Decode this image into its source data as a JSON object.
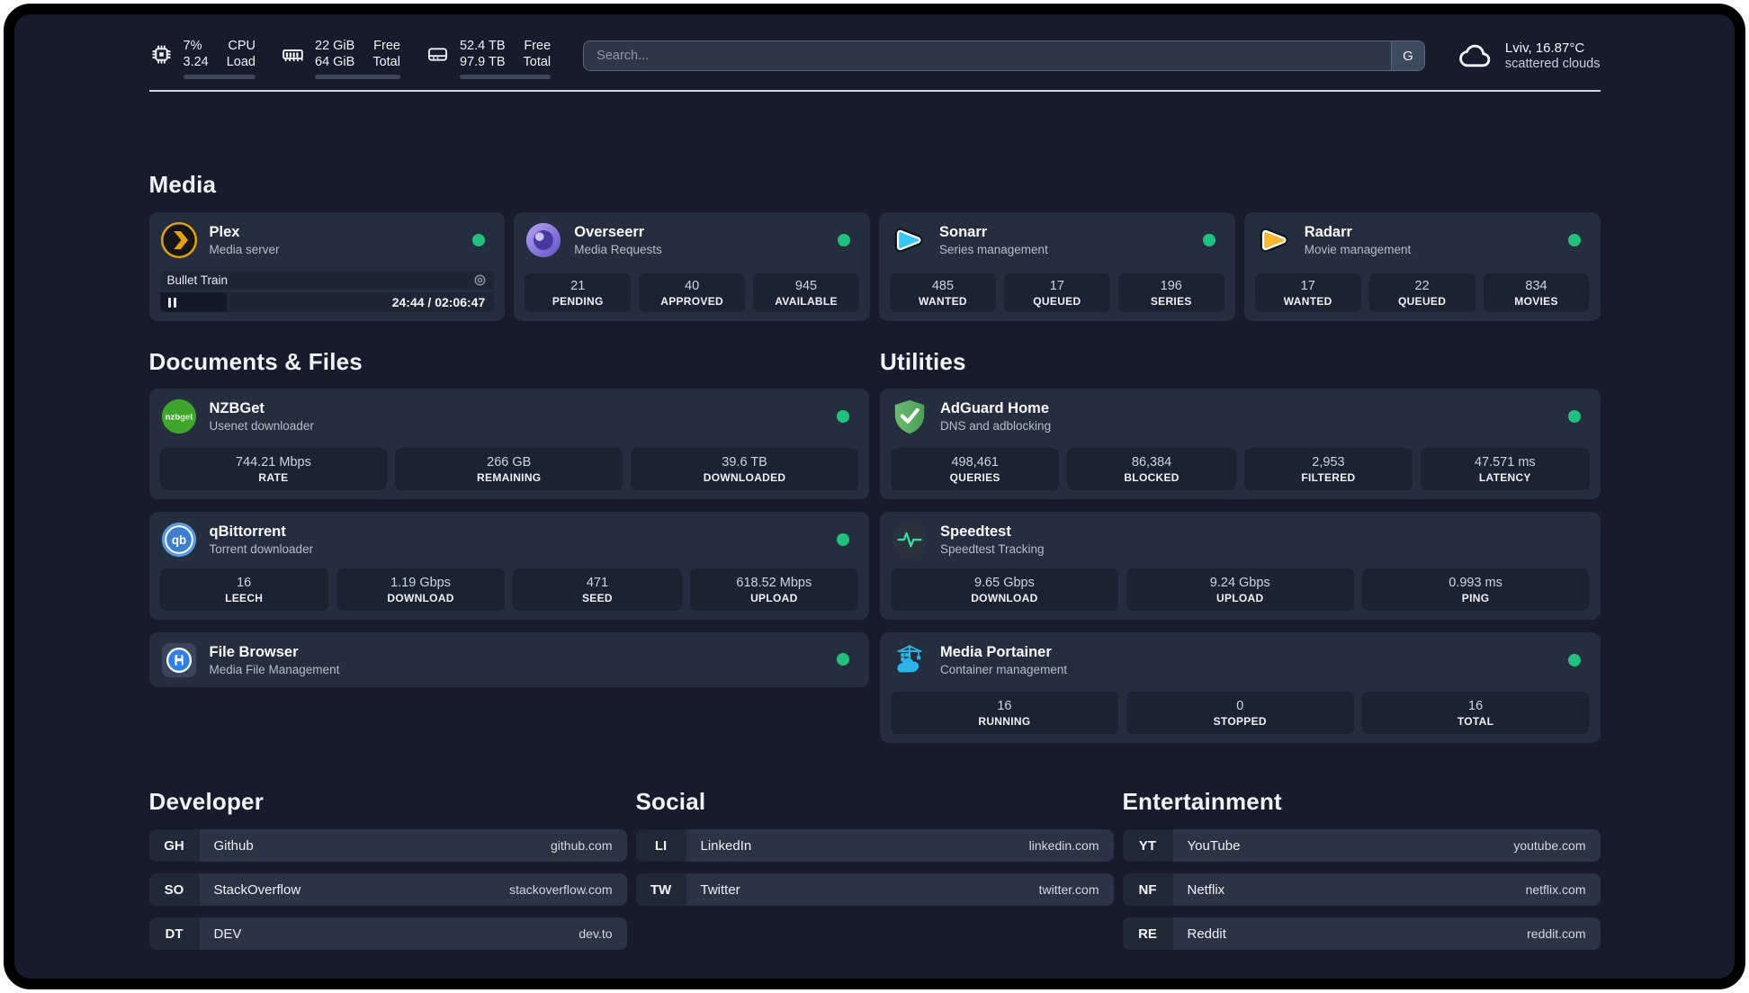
{
  "colors": {
    "background": "#161c2b",
    "card": "#252e3e",
    "tile": "#1a2332",
    "status_online": "#20c07d",
    "plex_amber": "#e5a00d",
    "sonarr_blue": "#38c6f4",
    "radarr_amber": "#f7b731",
    "nzbget_green": "#3fa52c",
    "qbittorrent_blue": "#5c9ae0",
    "adguard_green": "#5fae63",
    "speedtest_green": "#2fe0a4",
    "portainer_blue": "#2cb3e8"
  },
  "header": {
    "cpu": {
      "value_line1": "7%",
      "value_line2": "3.24",
      "label_line1": "CPU",
      "label_line2": "Load",
      "progress_percent": 8
    },
    "memory": {
      "value_line1": "22 GiB",
      "value_line2": "64 GiB",
      "label_line1": "Free",
      "label_line2": "Total",
      "progress_percent": 66
    },
    "disk": {
      "value_line1": "52.4 TB",
      "value_line2": "97.9 TB",
      "label_line1": "Free",
      "label_line2": "Total",
      "progress_percent": 47
    },
    "search": {
      "placeholder": "Search...",
      "engine_button": "G"
    },
    "weather": {
      "location": "Lviv, 16.87°C",
      "condition": "scattered clouds"
    }
  },
  "media": {
    "heading": "Media",
    "plex": {
      "name": "Plex",
      "description": "Media server",
      "status": "online",
      "now_playing": {
        "title": "Bullet Train",
        "time": "24:44 / 02:06:47",
        "progress_percent": 20,
        "state": "paused"
      }
    },
    "overseerr": {
      "name": "Overseerr",
      "description": "Media Requests",
      "status": "online",
      "stats": [
        {
          "value": "21",
          "label": "PENDING"
        },
        {
          "value": "40",
          "label": "APPROVED"
        },
        {
          "value": "945",
          "label": "AVAILABLE"
        }
      ]
    },
    "sonarr": {
      "name": "Sonarr",
      "description": "Series management",
      "status": "online",
      "stats": [
        {
          "value": "485",
          "label": "WANTED"
        },
        {
          "value": "17",
          "label": "QUEUED"
        },
        {
          "value": "196",
          "label": "SERIES"
        }
      ]
    },
    "radarr": {
      "name": "Radarr",
      "description": "Movie management",
      "status": "online",
      "stats": [
        {
          "value": "17",
          "label": "WANTED"
        },
        {
          "value": "22",
          "label": "QUEUED"
        },
        {
          "value": "834",
          "label": "MOVIES"
        }
      ]
    }
  },
  "documents": {
    "heading": "Documents & Files",
    "nzbget": {
      "name": "NZBGet",
      "description": "Usenet downloader",
      "status": "online",
      "stats": [
        {
          "value": "744.21 Mbps",
          "label": "RATE"
        },
        {
          "value": "266 GB",
          "label": "REMAINING"
        },
        {
          "value": "39.6 TB",
          "label": "DOWNLOADED"
        }
      ]
    },
    "qbittorrent": {
      "name": "qBittorrent",
      "description": "Torrent downloader",
      "status": "online",
      "stats": [
        {
          "value": "16",
          "label": "LEECH"
        },
        {
          "value": "1.19 Gbps",
          "label": "DOWNLOAD"
        },
        {
          "value": "471",
          "label": "SEED"
        },
        {
          "value": "618.52 Mbps",
          "label": "UPLOAD"
        }
      ]
    },
    "filebrowser": {
      "name": "File Browser",
      "description": "Media File Management",
      "status": "online"
    }
  },
  "utilities": {
    "heading": "Utilities",
    "adguard": {
      "name": "AdGuard Home",
      "description": "DNS and adblocking",
      "status": "online",
      "stats": [
        {
          "value": "498,461",
          "label": "QUERIES"
        },
        {
          "value": "86,384",
          "label": "BLOCKED"
        },
        {
          "value": "2,953",
          "label": "FILTERED"
        },
        {
          "value": "47.571 ms",
          "label": "LATENCY"
        }
      ]
    },
    "speedtest": {
      "name": "Speedtest",
      "description": "Speedtest Tracking",
      "stats": [
        {
          "value": "9.65 Gbps",
          "label": "DOWNLOAD"
        },
        {
          "value": "9.24 Gbps",
          "label": "UPLOAD"
        },
        {
          "value": "0.993 ms",
          "label": "PING"
        }
      ]
    },
    "portainer": {
      "name": "Media Portainer",
      "description": "Container management",
      "status": "online",
      "stats": [
        {
          "value": "16",
          "label": "RUNNING"
        },
        {
          "value": "0",
          "label": "STOPPED"
        },
        {
          "value": "16",
          "label": "TOTAL"
        }
      ]
    }
  },
  "link_groups": [
    {
      "heading": "Developer",
      "links": [
        {
          "abbr": "GH",
          "name": "Github",
          "domain": "github.com"
        },
        {
          "abbr": "SO",
          "name": "StackOverflow",
          "domain": "stackoverflow.com"
        },
        {
          "abbr": "DT",
          "name": "DEV",
          "domain": "dev.to"
        }
      ]
    },
    {
      "heading": "Social",
      "links": [
        {
          "abbr": "LI",
          "name": "LinkedIn",
          "domain": "linkedin.com"
        },
        {
          "abbr": "TW",
          "name": "Twitter",
          "domain": "twitter.com"
        }
      ]
    },
    {
      "heading": "Entertainment",
      "links": [
        {
          "abbr": "YT",
          "name": "YouTube",
          "domain": "youtube.com"
        },
        {
          "abbr": "NF",
          "name": "Netflix",
          "domain": "netflix.com"
        },
        {
          "abbr": "RE",
          "name": "Reddit",
          "domain": "reddit.com"
        }
      ]
    }
  ]
}
